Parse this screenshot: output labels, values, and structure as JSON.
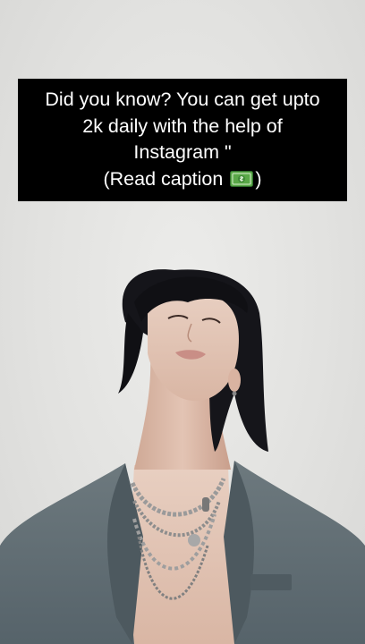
{
  "caption": {
    "line1": "Did you know? You can get upto",
    "line2": "2k daily with the help of",
    "line3": "Instagram \"",
    "line4_prefix": "(Read caption ",
    "line4_suffix": ")"
  },
  "icons": {
    "money": "dollar-banknote-icon"
  },
  "colors": {
    "background": "#e4e4e2",
    "caption_bg": "#000000",
    "caption_text": "#ffffff",
    "suit": "#5f6b70",
    "hair": "#15151a"
  }
}
